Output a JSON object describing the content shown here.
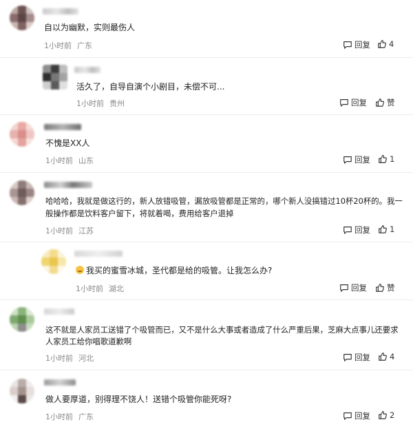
{
  "labels": {
    "reply": "回复",
    "like_zero": "赞"
  },
  "comments": [
    {
      "text": "自以为幽默，实则最伤人",
      "time": "1小时前",
      "region": "广东",
      "likes": "4"
    },
    {
      "text": "活久了，自导自演个小剧目，未偿不可...",
      "time": "1小时前",
      "region": "贵州",
      "likes": "赞"
    },
    {
      "text": "不愧是XX人",
      "time": "1小时前",
      "region": "山东",
      "likes": "1"
    },
    {
      "text_line1": "哈哈哈，我就是做这行的，新人放错吸管，漏放吸管都是正常的，哪个新人没搞错过10杯20杯的。我一",
      "text_line2": "般操作都是饮料客户留下，将就着喝，费用给客户退掉",
      "time": "1小时前",
      "region": "江苏",
      "likes": "1"
    },
    {
      "text": "我买的蜜雪冰城，圣代都是给的吸管。让我怎么办?",
      "time": "1小时前",
      "region": "湖北",
      "likes": "赞"
    },
    {
      "text_line1": "这不就是人家员工送错了个吸管而已，又不是什么大事或者造成了什么严重后果，芝麻大点事儿还要求",
      "text_line2": "人家员工给你唱歌道歉啊",
      "time": "1小时前",
      "region": "河北",
      "likes": "4"
    },
    {
      "text": "做人要厚道，别得理不饶人！送错个吸管你能死呀?",
      "time": "1小时前",
      "region": "广东",
      "likes": "2"
    }
  ]
}
